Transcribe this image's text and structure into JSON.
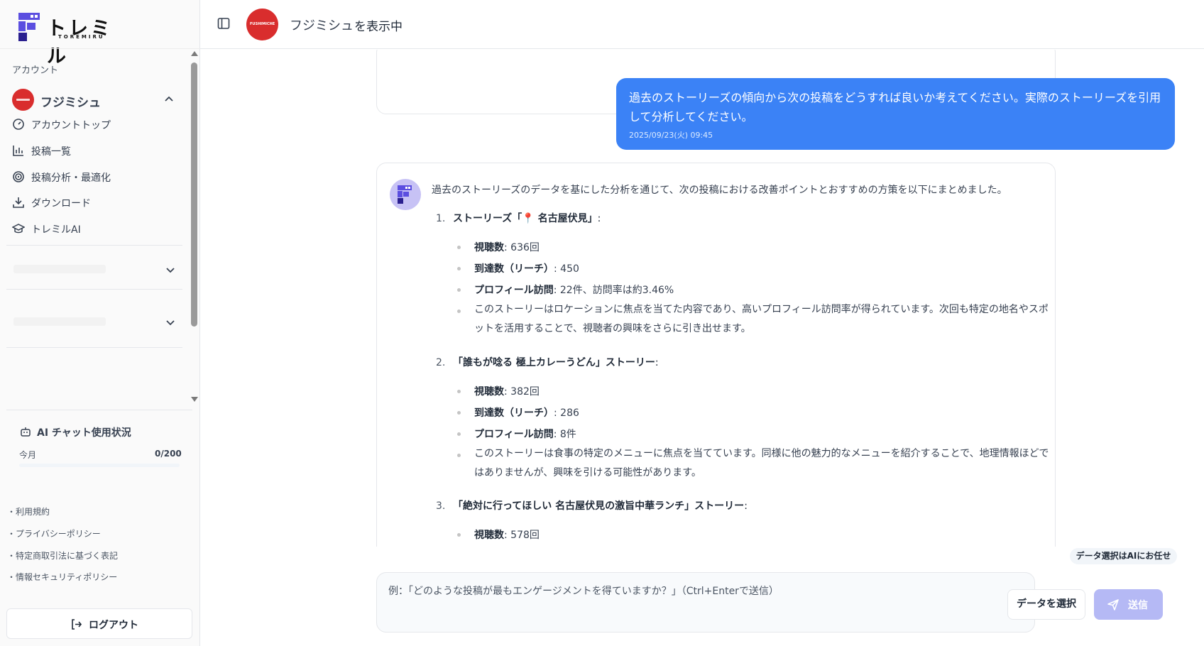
{
  "brand": {
    "name": "トレミル",
    "sub": "TOREMIRU",
    "colors": {
      "primary": "#5b4ee0",
      "dark": "#2a1f8f"
    }
  },
  "sidebar": {
    "section_label": "アカウント",
    "account": {
      "name": "フジミシュ",
      "avatar_color": "#d92d2d"
    },
    "nav": [
      {
        "label": "アカウントトップ",
        "icon": "gauge-icon"
      },
      {
        "label": "投稿一覧",
        "icon": "bar-chart-icon"
      },
      {
        "label": "投稿分析・最適化",
        "icon": "target-icon"
      },
      {
        "label": "ダウンロード",
        "icon": "download-icon"
      },
      {
        "label": "トレミルAI",
        "icon": "graduation-cap-icon"
      }
    ],
    "usage": {
      "title": "AI チャット使用状況",
      "period": "今月",
      "count": "0/200",
      "progress": 0
    },
    "footer_links": [
      "・利用規約",
      "・プライバシーポリシー",
      "・特定商取引法に基づく表記",
      "・情報セキュリティポリシー"
    ],
    "logout_label": "ログアウト"
  },
  "header": {
    "account_name": "フジミシュ",
    "suffix": "を表示中",
    "avatar_text": "FUSHIMICHE"
  },
  "chat": {
    "user_message": {
      "text": "過去のストーリーズの傾向から次の投稿をどうすれば良いか考えてください。実際のストーリーズを引用して分析してください。",
      "time": "2025/09/23(火) 09:45"
    },
    "ai_message": {
      "intro": "過去のストーリーズのデータを基にした分析を通じて、次の投稿における改善ポイントとおすすめの方策を以下にまとめました。",
      "items": [
        {
          "num": "1.",
          "title": "ストーリーズ「📍 名古屋伏見」",
          "title_suffix": ":",
          "bullets": [
            {
              "key": "視聴数",
              "value": ": 636回"
            },
            {
              "key": "到達数（リーチ）",
              "value": ": 450"
            },
            {
              "key": "プロフィール訪問",
              "value": ": 22件、訪問率は約3.46%"
            },
            {
              "key": "",
              "value": "このストーリーはロケーションに焦点を当てた内容であり、高いプロフィール訪問率が得られています。次回も特定の地名やスポットを活用することで、視聴者の興味をさらに引き出せます。"
            }
          ]
        },
        {
          "num": "2.",
          "title": "「誰もが唸る 極上カレーうどん」ストーリー",
          "title_suffix": ":",
          "bullets": [
            {
              "key": "視聴数",
              "value": ": 382回"
            },
            {
              "key": "到達数（リーチ）",
              "value": ": 286"
            },
            {
              "key": "プロフィール訪問",
              "value": ": 8件"
            },
            {
              "key": "",
              "value": "このストーリーは食事の特定のメニューに焦点を当てています。同様に他の魅力的なメニューを紹介することで、地理情報ほどではありませんが、興味を引ける可能性があります。"
            }
          ]
        },
        {
          "num": "3.",
          "title": "「絶対に行ってほしい 名古屋伏見の激旨中華ランチ」ストーリー",
          "title_suffix": ":",
          "bullets": [
            {
              "key": "視聴数",
              "value": ": 578回"
            }
          ]
        }
      ]
    }
  },
  "composer": {
    "ai_chip": "データ選択はAIにお任せ",
    "placeholder": "例：「どのような投稿が最もエンゲージメントを得ていますか？」（Ctrl+Enterで送信）",
    "select_data_label": "データを選択",
    "send_label": "送信"
  }
}
